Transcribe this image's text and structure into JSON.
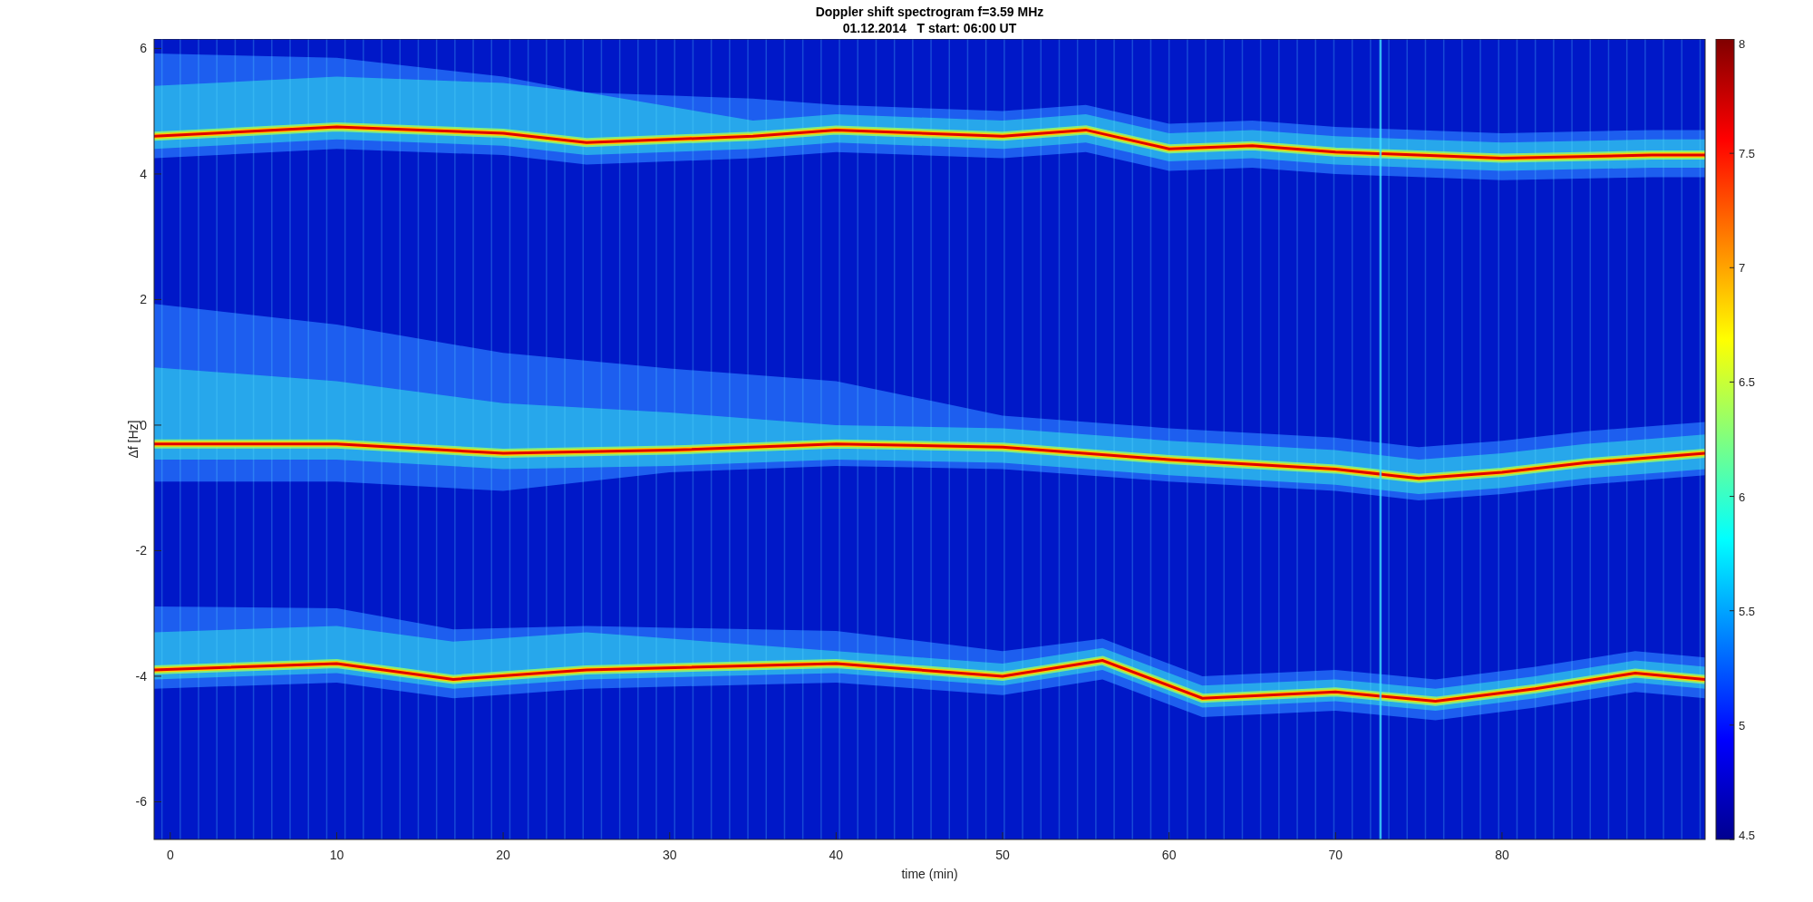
{
  "figure": {
    "title": "Doppler shift spectrogram f=3.59 MHz",
    "subtitle": "01.12.2014   T start: 06:00 UT"
  },
  "axes": {
    "xlabel": "time (min)",
    "ylabel": "Δf [Hz]",
    "xticks": [
      "0",
      "10",
      "20",
      "30",
      "40",
      "50",
      "60",
      "70",
      "80"
    ],
    "yticks": [
      "6",
      "4",
      "2",
      "0",
      "-2",
      "-4",
      "-6"
    ]
  },
  "colorbar": {
    "ticks": [
      "8",
      "7.5",
      "7",
      "6.5",
      "6",
      "5.5",
      "5",
      "4.5"
    ]
  }
}
